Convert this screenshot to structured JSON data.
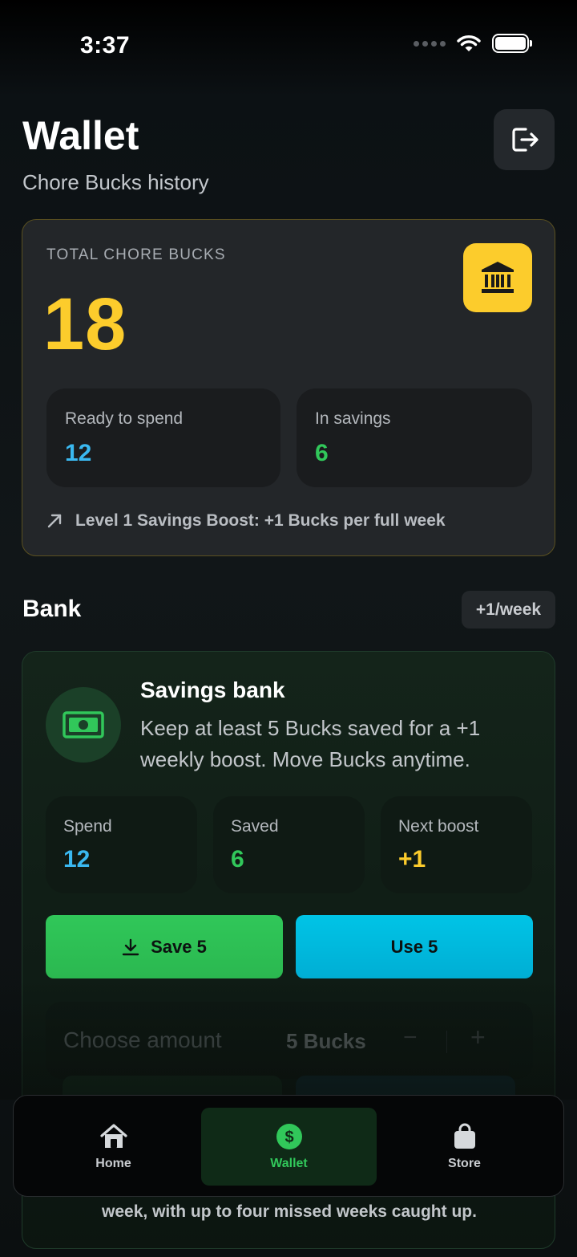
{
  "status": {
    "time": "3:37"
  },
  "header": {
    "title": "Wallet",
    "subtitle": "Chore Bucks history"
  },
  "total": {
    "label": "TOTAL CHORE BUCKS",
    "value": "18",
    "ready_label": "Ready to spend",
    "ready_value": "12",
    "savings_label": "In savings",
    "savings_value": "6",
    "boost_text": "Level 1 Savings Boost: +1 Bucks per full week"
  },
  "bank": {
    "section_title": "Bank",
    "rate_pill": "+1/week",
    "card_title": "Savings bank",
    "card_desc": "Keep at least 5 Bucks saved for a +1 weekly boost. Move Bucks anytime.",
    "stats": [
      {
        "label": "Spend",
        "value": "12",
        "color": "#3ab8f0"
      },
      {
        "label": "Saved",
        "value": "6",
        "color": "#31c75a"
      },
      {
        "label": "Next boost",
        "value": "+1",
        "color": "#fccc2c"
      }
    ],
    "save_label": "Save 5",
    "use_label": "Use 5",
    "amount_label": "Choose amount",
    "amount_value": "5 Bucks",
    "minus": "−",
    "plus": "+",
    "footer_text": "week, with up to four missed weeks caught up."
  },
  "tabs": [
    {
      "label": "Home",
      "icon": "home-icon"
    },
    {
      "label": "Wallet",
      "icon": "dollar-coin-icon"
    },
    {
      "label": "Store",
      "icon": "shopping-bag-icon"
    }
  ],
  "colors": {
    "accent_yellow": "#fccc2c",
    "accent_green": "#31c75a",
    "accent_blue": "#3ab8f0",
    "accent_cyan": "#00bfe0"
  }
}
